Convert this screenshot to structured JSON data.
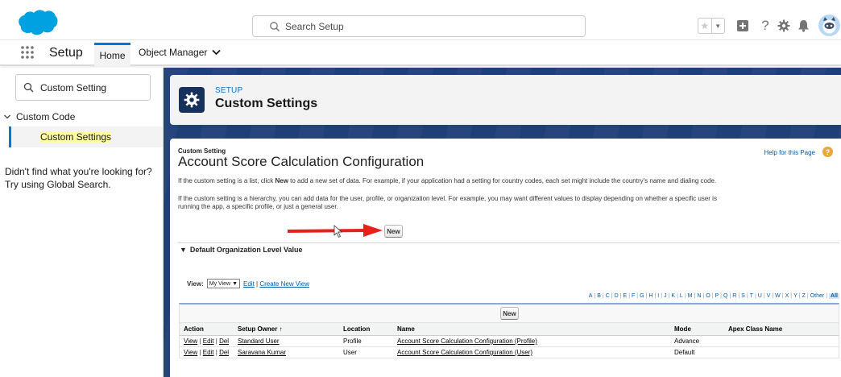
{
  "header": {
    "search_placeholder": "Search Setup",
    "icons": [
      "salesforce-cloud-logo",
      "favorites-star-icon",
      "chevron-down-icon",
      "add-icon",
      "help-icon",
      "gear-icon",
      "bell-icon",
      "avatar"
    ],
    "colors": {
      "brand": "#00a1e0",
      "accent": "#0176d3"
    }
  },
  "context_nav": {
    "app_name": "Setup",
    "tabs": [
      {
        "label": "Home",
        "active": true
      },
      {
        "label": "Object Manager",
        "active": false
      }
    ]
  },
  "sidebar": {
    "quick_find_value": "Custom Setting",
    "group_label": "Custom Code",
    "active_item": "Custom Settings",
    "help_text_line1": "Didn't find what you're looking for?",
    "help_text_line2": "Try using Global Search."
  },
  "page_header": {
    "eyebrow": "SETUP",
    "title": "Custom Settings"
  },
  "detail": {
    "eyebrow": "Custom Setting",
    "title": "Account Score Calculation Configuration",
    "help_link": "Help for this Page",
    "para1_pre": "If the custom setting is a list, click ",
    "para1_bold": "New",
    "para1_post": " to add a new set of data. For example, if your application had a setting for country codes, each set might include the country's name and dialing code.",
    "para2_line1": "If the custom setting is a hierarchy, you can add data for the user, profile, or organization level. For example, you may want different values to display depending on whether a specific user is",
    "para2_line2": "running the app, a specific profile, or just a general user.",
    "new_button": "New",
    "section_title": "Default Organization Level Value"
  },
  "list_view": {
    "view_label": "View:",
    "view_selected": "My View",
    "edit_link": "Edit",
    "create_link": "Create New View",
    "alpha": [
      "A",
      "B",
      "C",
      "D",
      "E",
      "F",
      "G",
      "H",
      "I",
      "J",
      "K",
      "L",
      "M",
      "N",
      "O",
      "P",
      "Q",
      "R",
      "S",
      "T",
      "U",
      "V",
      "W",
      "X",
      "Y",
      "Z",
      "Other",
      "All"
    ],
    "new_button": "New",
    "columns": [
      "Action",
      "Setup Owner ↑",
      "Location",
      "Name",
      "Mode",
      "Apex Class Name"
    ],
    "action_view": "View",
    "action_edit": "Edit",
    "action_del": "Del",
    "rows": [
      {
        "owner": "Standard User",
        "location": "Profile",
        "name": "Account Score Calculation Configuration (Profile)",
        "mode": "Advance",
        "apex": ""
      },
      {
        "owner": "Saravana Kumar",
        "location": "User",
        "name": "Account Score Calculation Configuration (User)",
        "mode": "Default",
        "apex": ""
      }
    ]
  }
}
